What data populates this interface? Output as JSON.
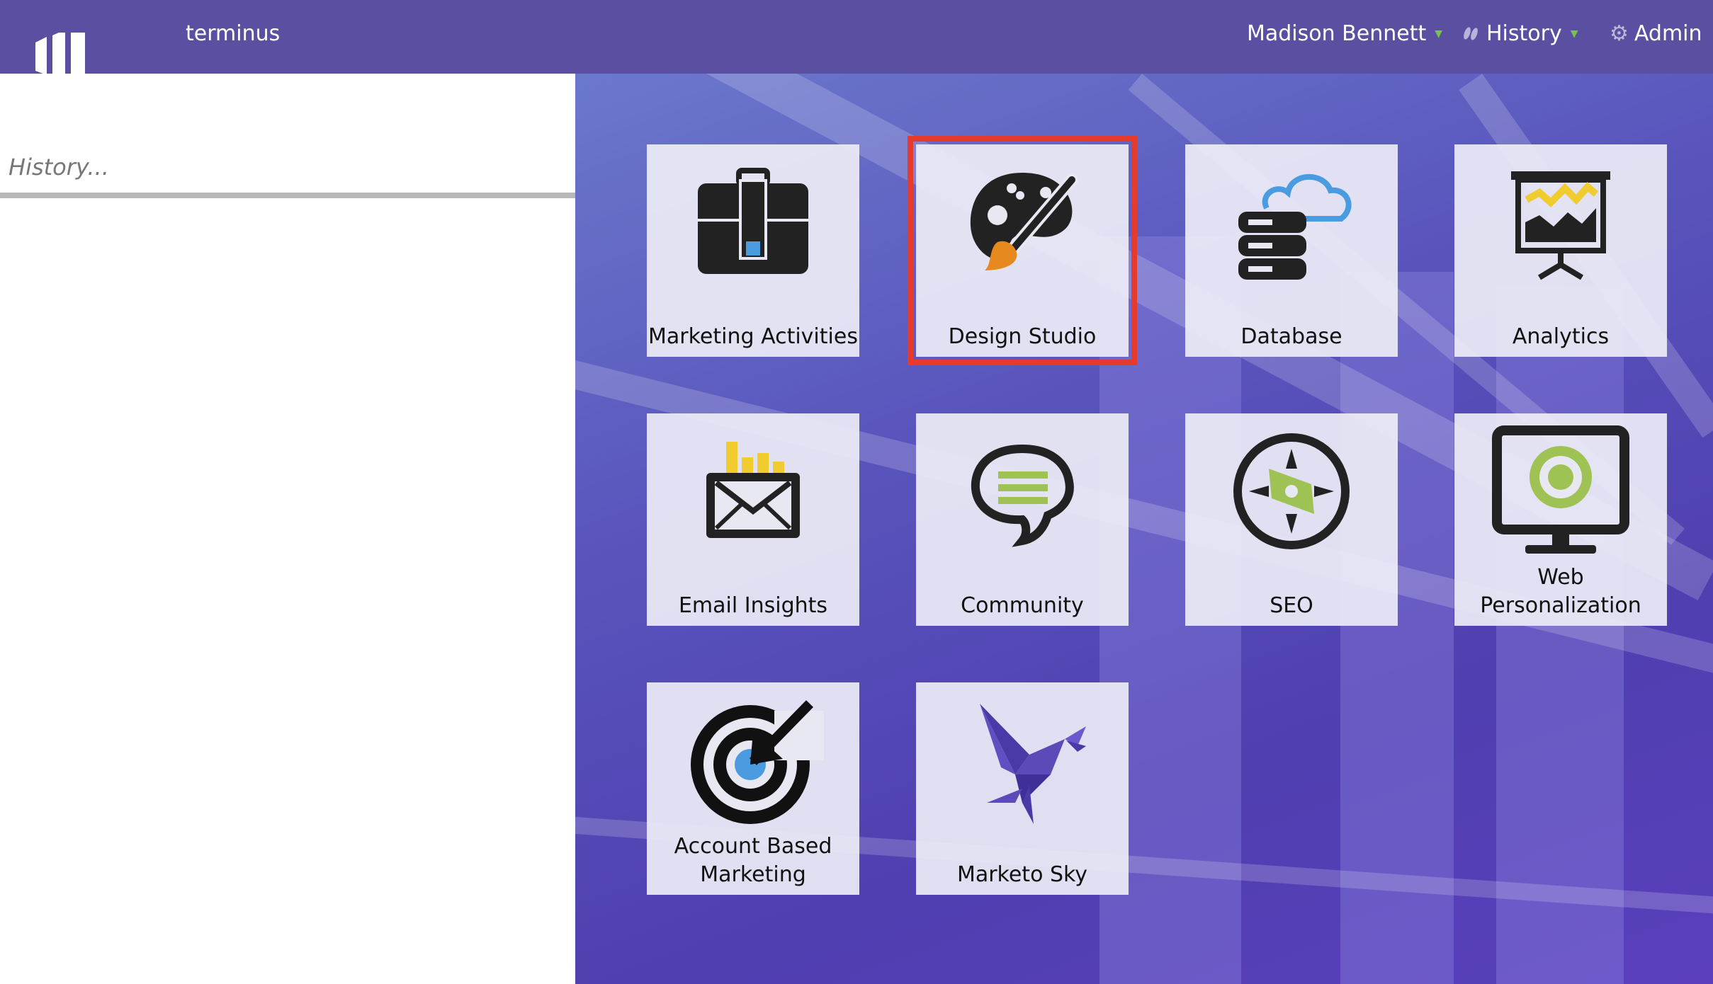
{
  "header": {
    "brand": "terminus",
    "user": "Madison Bennett",
    "history": "History",
    "admin": "Admin"
  },
  "sidebar": {
    "search_placeholder": "History..."
  },
  "tiles": [
    {
      "label": "Marketing Activities",
      "icon": "briefcase-icon"
    },
    {
      "label": "Design Studio",
      "icon": "palette-icon",
      "selected": true
    },
    {
      "label": "Database",
      "icon": "database-cloud-icon"
    },
    {
      "label": "Analytics",
      "icon": "presentation-chart-icon"
    },
    {
      "label": "Email Insights",
      "icon": "email-chart-icon"
    },
    {
      "label": "Community",
      "icon": "speech-bubble-icon"
    },
    {
      "label": "SEO",
      "icon": "compass-icon"
    },
    {
      "label": "Web Personalization",
      "icon": "monitor-target-icon"
    },
    {
      "label": "Account Based Marketing",
      "icon": "target-arrow-icon"
    },
    {
      "label": "Marketo Sky",
      "icon": "origami-bird-icon"
    }
  ],
  "colors": {
    "topbar": "#5a4fa0",
    "selection": "#e53a2c",
    "accent_green": "#7cc242",
    "accent_blue": "#4a9be0",
    "accent_yellow": "#f0cc2e"
  }
}
